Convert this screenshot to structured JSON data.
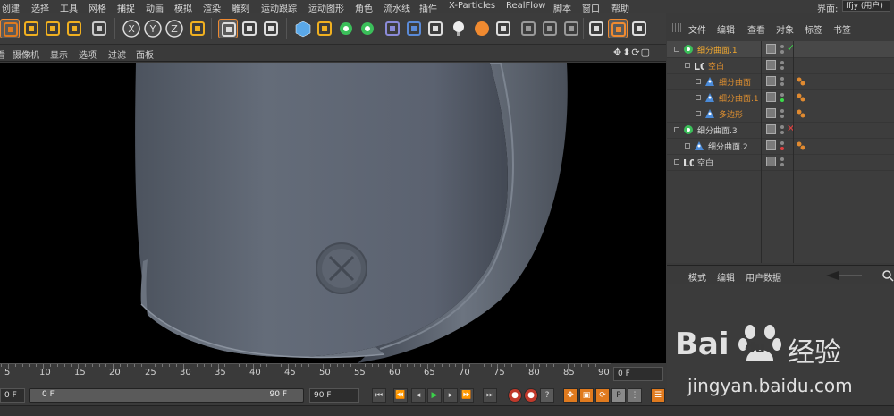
{
  "menubar": {
    "items": [
      "创建",
      "选择",
      "工具",
      "网格",
      "捕捉",
      "动画",
      "模拟",
      "渲染",
      "雕刻",
      "运动跟踪",
      "运动图形",
      "角色",
      "流水线",
      "插件",
      "X-Particles",
      "RealFlow",
      "脚本",
      "窗口",
      "帮助"
    ],
    "layout_label": "界面:",
    "layout_value": "ffjy (用户)"
  },
  "toolbar": {
    "icons": [
      "select-icon",
      "move-icon",
      "scale-icon",
      "rotate-icon",
      "object-mode-icon",
      "x-axis-icon",
      "y-axis-icon",
      "z-axis-icon",
      "coordinate-system-icon",
      "render-view-icon",
      "render-picture-viewer-icon",
      "render-settings-icon",
      "cube-icon",
      "pen-icon",
      "subdivision-icon",
      "array-icon",
      "deformer-icon",
      "floor-icon",
      "camera-icon",
      "light-icon",
      "material-icon",
      "sound-icon",
      "ik-icon",
      "hair-icon",
      "cloth-icon",
      "clapper-icon",
      "viewport-solo-icon",
      "axis-icon"
    ]
  },
  "viewport": {
    "menu": [
      "看",
      "摄像机",
      "显示",
      "选项",
      "过滤",
      "面板"
    ]
  },
  "timeline": {
    "ticks": [
      5,
      10,
      15,
      20,
      25,
      30,
      35,
      40,
      45,
      50,
      55,
      60,
      65,
      70,
      75,
      80,
      85,
      90
    ],
    "current_frame": "0 F",
    "start_field": "0 F",
    "range_start": "0 F",
    "range_end": "90 F",
    "end_field": "90 F"
  },
  "object_manager": {
    "menu": [
      "文件",
      "编辑",
      "查看",
      "对象",
      "标签",
      "书签"
    ],
    "objects": [
      {
        "name": "细分曲面.1",
        "depth": 0,
        "color": "#f0a830",
        "icon": "subdivision-icon",
        "status": "check"
      },
      {
        "name": "空白",
        "depth": 1,
        "color": "#e09030",
        "icon": "null-icon",
        "status": "none"
      },
      {
        "name": "细分曲面",
        "depth": 2,
        "color": "#e09030",
        "icon": "polygon-icon",
        "status": "none"
      },
      {
        "name": "细分曲面.1",
        "depth": 2,
        "color": "#e09030",
        "icon": "polygon-icon",
        "status": "green-dot"
      },
      {
        "name": "多边形",
        "depth": 2,
        "color": "#e09030",
        "icon": "polygon-icon",
        "status": "none"
      },
      {
        "name": "细分曲面.3",
        "depth": 0,
        "color": "#d4d4d4",
        "icon": "subdivision-icon",
        "status": "x"
      },
      {
        "name": "细分曲面.2",
        "depth": 1,
        "color": "#d4d4d4",
        "icon": "polygon-icon",
        "status": "red-dot"
      },
      {
        "name": "空白",
        "depth": 0,
        "color": "#d4d4d4",
        "icon": "null-icon",
        "status": "none"
      }
    ]
  },
  "attribute_manager": {
    "menu": [
      "模式",
      "编辑",
      "用户数据"
    ]
  },
  "watermark": {
    "brand_a": "Bai",
    "brand_b": "du",
    "suffix": "经验",
    "url": "jingyan.baidu.com"
  },
  "colors": {
    "accent": "#f08a30",
    "panel": "#3d3d3d",
    "viewport_bg": "#000000",
    "model": "#5f6774"
  }
}
